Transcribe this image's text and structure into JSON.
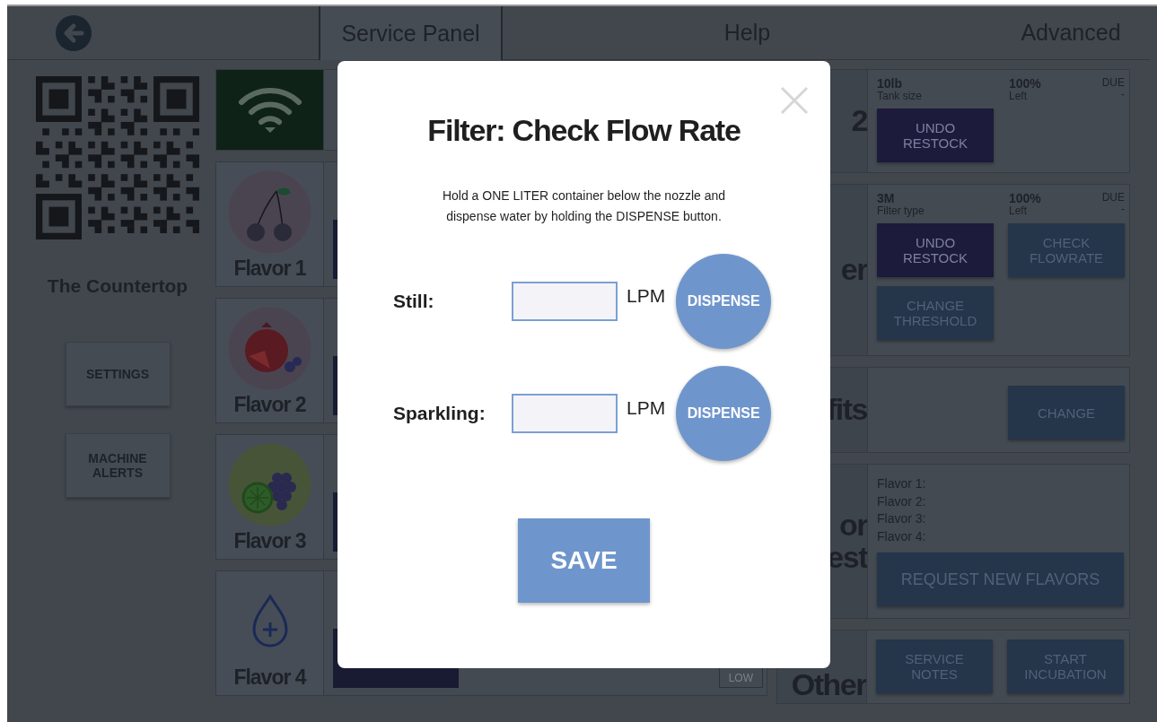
{
  "header": {
    "tabs": [
      {
        "label": "Service Panel",
        "selected": true
      },
      {
        "label": "Help",
        "selected": false
      },
      {
        "label": "Advanced",
        "selected": false
      }
    ]
  },
  "sidebar": {
    "title": "The Countertop",
    "buttons": [
      "SETTINGS",
      "MACHINE ALERTS"
    ]
  },
  "flavors": [
    {
      "label": "Flavor 1",
      "kind": "cherry"
    },
    {
      "label": "Flavor 2",
      "kind": "pomegranate"
    },
    {
      "label": "Flavor 3",
      "kind": "grape"
    },
    {
      "label": "Flavor 4",
      "kind": "add",
      "badge": "LOW"
    }
  ],
  "panels": [
    {
      "kind": "stats",
      "label": [
        "2"
      ],
      "stats": [
        {
          "value": "10lb",
          "caption": "Tank size"
        },
        {
          "value": "100%",
          "caption": "Left"
        }
      ],
      "due": {
        "label": "DUE",
        "value": "-"
      },
      "buttons": [
        {
          "label": "UNDO RESTOCK",
          "kind": "dark"
        }
      ]
    },
    {
      "kind": "stats",
      "label": [
        "er"
      ],
      "stats": [
        {
          "value": "3M",
          "caption": "Filter type"
        },
        {
          "value": "100%",
          "caption": "Left"
        }
      ],
      "due": {
        "label": "DUE",
        "value": "-"
      },
      "buttons": [
        {
          "label": "UNDO RESTOCK",
          "kind": "dark"
        },
        {
          "label": "CHECK FLOWRATE",
          "kind": "muted"
        },
        {
          "label": "CHANGE THRESHOLD",
          "kind": "muted"
        }
      ]
    },
    {
      "kind": "action",
      "label": [
        "fits"
      ],
      "buttons": [
        {
          "label": "CHANGE",
          "kind": "muted"
        }
      ]
    },
    {
      "kind": "list",
      "label": [
        "or",
        "est"
      ],
      "lines": [
        "Flavor 1:",
        "Flavor 2:",
        "Flavor 3:",
        "Flavor 4:"
      ],
      "buttons": [
        {
          "label": "REQUEST NEW FLAVORS",
          "kind": "wide"
        }
      ]
    },
    {
      "kind": "buttons",
      "label": [
        "Other"
      ],
      "buttons": [
        {
          "label": "SERVICE NOTES",
          "kind": "muted"
        },
        {
          "label": "START INCUBATION",
          "kind": "muted"
        }
      ]
    }
  ],
  "dialog": {
    "title": "Filter: Check Flow Rate",
    "instructions": "Hold a ONE LITER container below the nozzle and\ndispense water by holding the DISPENSE button.",
    "rows": [
      {
        "label": "Still:",
        "unit": "LPM",
        "button": "DISPENSE"
      },
      {
        "label": "Sparkling:",
        "unit": "LPM",
        "button": "DISPENSE"
      }
    ],
    "save": "SAVE"
  }
}
